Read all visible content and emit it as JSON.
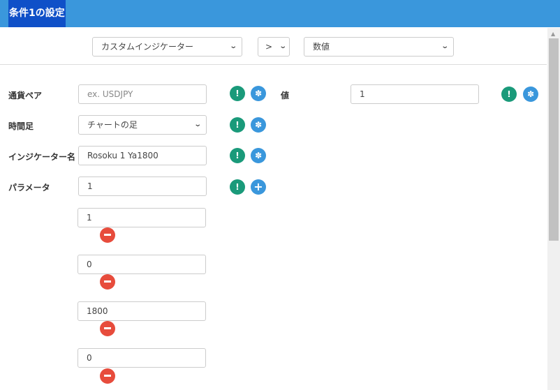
{
  "header": {
    "title": "条件1の設定"
  },
  "top": {
    "type_select": "カスタムインジケーター",
    "operator_select": ">",
    "compare_select": "数値"
  },
  "form": {
    "pair": {
      "label": "通貨ペア",
      "placeholder": "ex. USDJPY"
    },
    "timeframe": {
      "label": "時間足",
      "value": "チャートの足"
    },
    "indicator": {
      "label": "インジケーター名",
      "value": "Rosoku 1 Ya1800"
    },
    "params": {
      "label": "パラメータ",
      "value": "1",
      "extra": [
        "1",
        "0",
        "1800",
        "0"
      ]
    },
    "value": {
      "label": "値",
      "value": "1"
    }
  },
  "colors": {
    "header": "#3a97dc",
    "title_bg": "#0f50c8",
    "info": "#1a9a7a",
    "settings": "#3a97dc",
    "remove": "#e74c3c"
  }
}
